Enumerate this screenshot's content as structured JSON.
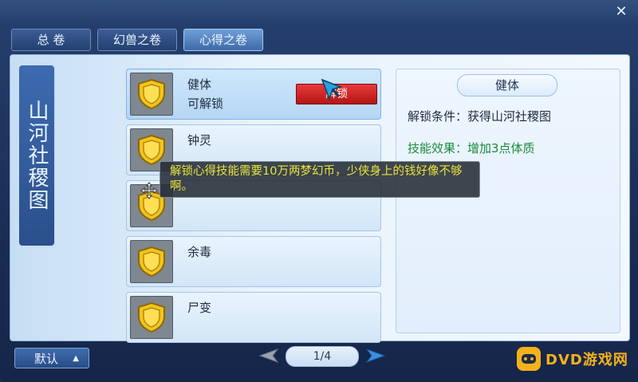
{
  "tabs": [
    {
      "label": "总 卷"
    },
    {
      "label": "幻兽之卷"
    },
    {
      "label": "心得之卷"
    }
  ],
  "banner": {
    "text": "山河社稷图"
  },
  "skills": [
    {
      "name": "健体",
      "status": "可解锁",
      "unlock_label": "解锁",
      "icon": "shield-icon"
    },
    {
      "name": "钟灵",
      "status": "",
      "icon": "shield-icon"
    },
    {
      "name": "",
      "status": "",
      "icon": "shield-icon"
    },
    {
      "name": "余毒",
      "status": "",
      "icon": "shield-icon"
    },
    {
      "name": "尸变",
      "status": "",
      "icon": "shield-icon"
    }
  ],
  "detail": {
    "title": "健体",
    "condition": "解锁条件：获得山河社稷图",
    "effect": "技能效果：增加3点体质"
  },
  "tooltip": {
    "text": "解锁心得技能需要10万两梦幻币，少侠身上的钱好像不够啊。"
  },
  "footer": {
    "sort_label": "默认",
    "page": "1/4"
  },
  "watermark": {
    "text": "DVD游戏网"
  },
  "colors": {
    "accent": "#3e6aa8",
    "unlock_button": "#d32020",
    "effect_text": "#1a8a3a",
    "tooltip_text": "#e8e43a"
  }
}
